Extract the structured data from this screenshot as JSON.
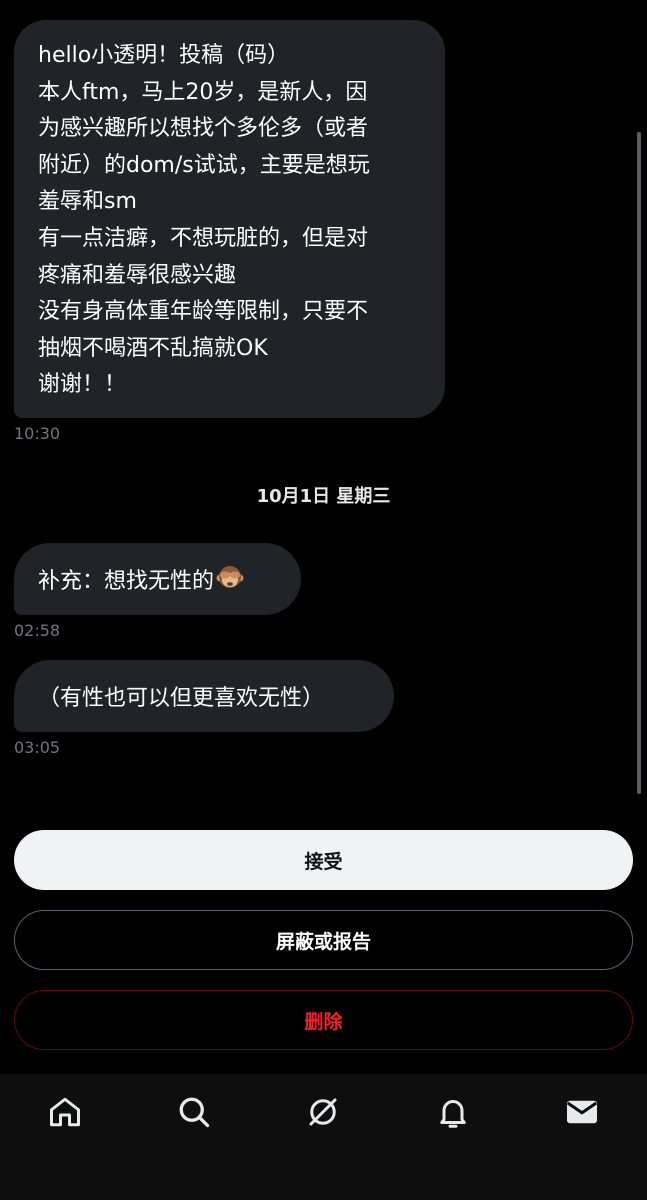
{
  "chat": {
    "message_1": {
      "lines": [
        "hello小透明！投稿（码）",
        "本人ftm，马上20岁，是新人，因",
        "为感兴趣所以想找个多伦多（或者",
        "附近）的dom/s试试，主要是想玩",
        "羞辱和sm",
        "有一点洁癖，不想玩脏的，但是对",
        "疼痛和羞辱很感兴趣",
        "没有身高体重年龄等限制，只要不",
        "抽烟不喝酒不乱搞就OK",
        "谢谢！！"
      ],
      "time": "10:30"
    },
    "date_separator": "10月1日 星期三",
    "message_2": {
      "text": "补充：想找无性的",
      "emoji": "see-no-evil-monkey-emoji",
      "time": "02:58"
    },
    "message_3": {
      "text": "（有性也可以但更喜欢无性）",
      "time": "03:05"
    }
  },
  "actions": {
    "accept_label": "接受",
    "block_report_label": "屏蔽或报告",
    "delete_label": "删除"
  },
  "nav": {
    "icons": [
      "home-icon",
      "search-icon",
      "grok-icon",
      "notifications-icon",
      "messages-icon"
    ]
  },
  "colors": {
    "background": "#000000",
    "bubble": "#202327",
    "timestamp": "#71767b",
    "accept_bg": "#eff3f4",
    "delete_text": "#f4212e",
    "delete_border": "#67070f"
  }
}
